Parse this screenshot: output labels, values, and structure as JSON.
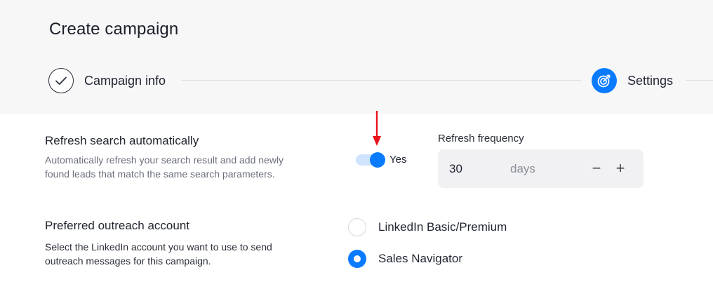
{
  "page": {
    "title": "Create campaign"
  },
  "steps": [
    {
      "label": "Campaign info",
      "status": "done",
      "icon": "check-icon"
    },
    {
      "label": "Settings",
      "status": "active",
      "icon": "target-icon"
    }
  ],
  "refresh": {
    "title": "Refresh search automatically",
    "description_line1": "Automatically refresh your search result and add newly",
    "description_line2": "found leads that match the same search parameters.",
    "toggle_on": true,
    "toggle_label": "Yes"
  },
  "frequency": {
    "label": "Refresh frequency",
    "value": "30",
    "unit": "days",
    "decrement_label": "−",
    "increment_label": "+"
  },
  "outreach": {
    "title": "Preferred outreach account",
    "description_line1": "Select the LinkedIn account you want to use to send",
    "description_line2": "outreach messages for this campaign.",
    "options": [
      {
        "label": "LinkedIn Basic/Premium",
        "selected": false
      },
      {
        "label": "Sales Navigator",
        "selected": true
      }
    ]
  },
  "colors": {
    "accent": "#0a7bff",
    "toggle_track": "#cfe4ff",
    "header_bg": "#f7f7f8",
    "annotation_arrow": "#e8141b"
  }
}
